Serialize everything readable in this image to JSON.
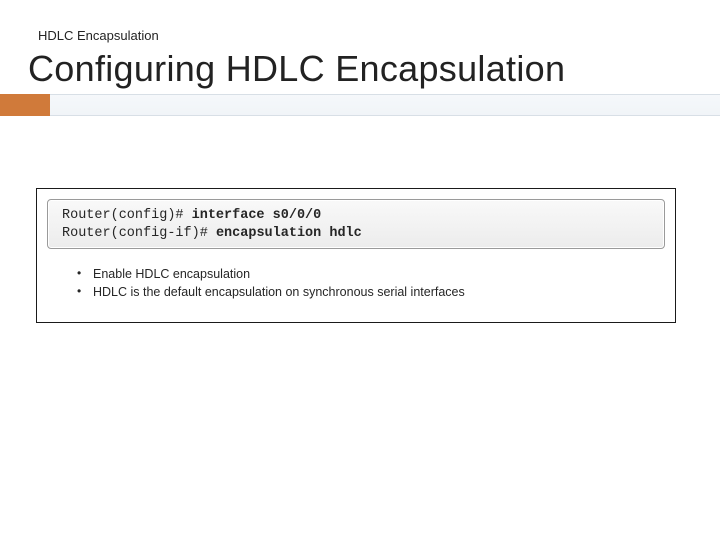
{
  "header": {
    "eyebrow": "HDLC Encapsulation",
    "title": "Configuring HDLC Encapsulation"
  },
  "codebox": {
    "line1_prompt": "Router(config)# ",
    "line1_cmd": "interface s0/0/0",
    "line2_prompt": "Router(config-if)# ",
    "line2_cmd": "encapsulation hdlc"
  },
  "bullets": {
    "items": [
      "Enable HDLC encapsulation",
      "HDLC is the default encapsulation on synchronous serial interfaces"
    ]
  }
}
